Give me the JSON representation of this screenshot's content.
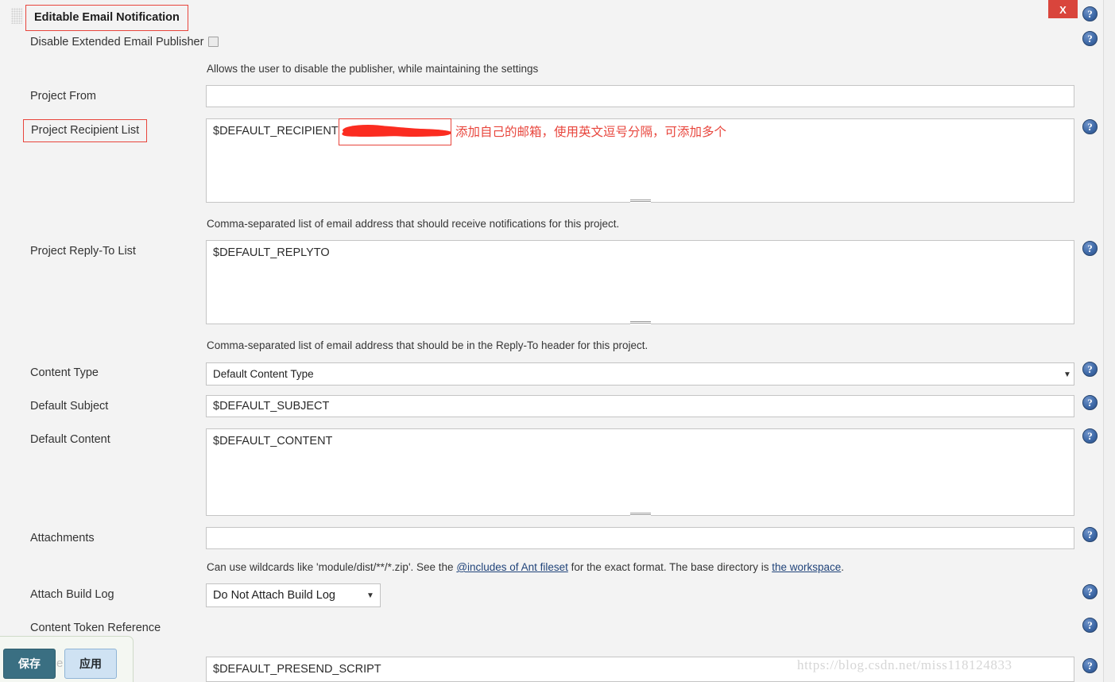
{
  "window": {
    "close_label": "X",
    "section_title": "Editable Email Notification",
    "drag_handle_name": "drag-handle"
  },
  "help_icon_glyph": "?",
  "colors": {
    "annotation_red": "#e8453c",
    "close_button_red": "#d9453c",
    "save_button": "#3a6f82",
    "apply_button": "#cfe2f3",
    "link_blue": "#21447a",
    "page_background": "#f3f3f3"
  },
  "fields": {
    "disable_publisher": {
      "label": "Disable Extended Email Publisher",
      "checked": false,
      "description": "Allows the user to disable the publisher, while maintaining the settings"
    },
    "project_from": {
      "label": "Project From",
      "value": ""
    },
    "project_recipient_list": {
      "label": "Project Recipient List",
      "value": "$DEFAULT_RECIPIENTS,",
      "redacted_placeholder": "",
      "annotation_cn": "添加自己的邮箱，使用英文逗号分隔，可添加多个",
      "description": "Comma-separated list of email address that should receive notifications for this project."
    },
    "project_reply_to_list": {
      "label": "Project Reply-To List",
      "value": "$DEFAULT_REPLYTO",
      "description": "Comma-separated list of email address that should be in the Reply-To header for this project."
    },
    "content_type": {
      "label": "Content Type",
      "value": "Default Content Type",
      "options": [
        "Default Content Type"
      ]
    },
    "default_subject": {
      "label": "Default Subject",
      "value": "$DEFAULT_SUBJECT"
    },
    "default_content": {
      "label": "Default Content",
      "value": "$DEFAULT_CONTENT"
    },
    "attachments": {
      "label": "Attachments",
      "value": "",
      "description_pre": "Can use wildcards like 'module/dist/**/*.zip'. See the ",
      "description_link1": "@includes of Ant fileset",
      "description_mid": " for the exact format. The base directory is ",
      "description_link2": "the workspace",
      "description_post": "."
    },
    "attach_build_log": {
      "label": "Attach Build Log",
      "value": "Do Not Attach Build Log",
      "options": [
        "Do Not Attach Build Log"
      ]
    },
    "content_token_reference": {
      "label": "Content Token Reference"
    },
    "presend_script": {
      "value": "$DEFAULT_PRESEND_SCRIPT"
    }
  },
  "savebar": {
    "save_label": "保存",
    "apply_label": "应用",
    "ghost_text": "e"
  },
  "watermark": "https://blog.csdn.net/miss118124833"
}
